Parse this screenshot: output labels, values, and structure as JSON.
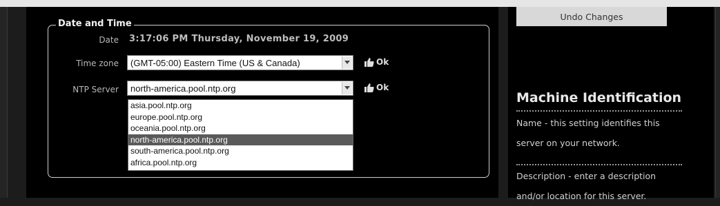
{
  "fieldset": {
    "legend": "Date and Time",
    "date_label": "Date",
    "date_value": "3:17:06 PM Thursday, November 19, 2009",
    "timezone_label": "Time zone",
    "timezone_value": "(GMT-05:00) Eastern Time (US & Canada)",
    "timezone_status": "Ok",
    "ntp_label": "NTP Server",
    "ntp_value": "north-america.pool.ntp.org",
    "ntp_status": "Ok",
    "ntp_options": [
      "asia.pool.ntp.org",
      "europe.pool.ntp.org",
      "oceania.pool.ntp.org",
      "north-america.pool.ntp.org",
      "south-america.pool.ntp.org",
      "africa.pool.ntp.org"
    ],
    "ntp_selected_index": 3
  },
  "sidebar": {
    "undo_label": "Undo Changes",
    "help_title": "Machine Identification",
    "help_name_text": "Name - this setting identifies this server on your network.",
    "help_description_text": "Description - enter a description and/or location for this server."
  },
  "icons": {
    "status_icon": "thumbs-up-icon",
    "select_arrow": "chevron-down-icon"
  },
  "colors": {
    "background": "#000000",
    "dropdown_highlight": "#5a5a5a",
    "button": "#d8d8d8"
  }
}
